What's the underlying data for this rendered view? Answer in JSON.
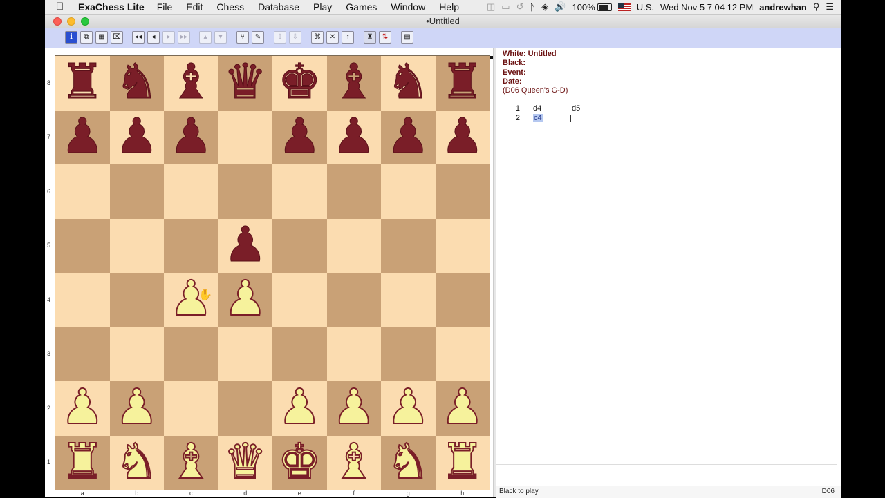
{
  "menubar": {
    "app_name": "ExaChess Lite",
    "items": [
      "File",
      "Edit",
      "Chess",
      "Database",
      "Play",
      "Games",
      "Window",
      "Help"
    ],
    "battery": "100%",
    "input_source": "U.S.",
    "clock": "Wed Nov 5  7 04 12 PM",
    "user": "andrewhan"
  },
  "window": {
    "title": "•Untitled"
  },
  "toolbar": {
    "buttons": [
      {
        "name": "info",
        "glyph": "i"
      },
      {
        "name": "copy",
        "glyph": "⧉"
      },
      {
        "name": "board",
        "glyph": "▦"
      },
      {
        "name": "delete",
        "glyph": "⌧"
      },
      {
        "name": "first",
        "glyph": "◂◂"
      },
      {
        "name": "prev",
        "glyph": "◂"
      },
      {
        "name": "next",
        "glyph": "▸"
      },
      {
        "name": "last",
        "glyph": "▸▸"
      },
      {
        "name": "var-up",
        "glyph": "▴"
      },
      {
        "name": "var-down",
        "glyph": "▾"
      },
      {
        "name": "tree",
        "glyph": "⑂"
      },
      {
        "name": "annotate",
        "glyph": "✎"
      },
      {
        "name": "promote",
        "glyph": "⇧"
      },
      {
        "name": "demote",
        "glyph": "⇩"
      },
      {
        "name": "analyze",
        "glyph": "⌘"
      },
      {
        "name": "stop",
        "glyph": "✕"
      },
      {
        "name": "go",
        "glyph": "↑"
      },
      {
        "name": "pieces",
        "glyph": "♜"
      },
      {
        "name": "flip",
        "glyph": "⇅"
      },
      {
        "name": "notes",
        "glyph": "▤"
      }
    ]
  },
  "board": {
    "rank_labels": [
      "8",
      "7",
      "6",
      "5",
      "4",
      "3",
      "2",
      "1"
    ],
    "file_labels": [
      "a",
      "b",
      "c",
      "d",
      "e",
      "f",
      "g",
      "h"
    ],
    "position": [
      [
        "r",
        "n",
        "b",
        "q",
        "k",
        "b",
        "n",
        "r"
      ],
      [
        "p",
        "p",
        "p",
        "",
        "p",
        "p",
        "p",
        "p"
      ],
      [
        "",
        "",
        "",
        "",
        "",
        "",
        "",
        ""
      ],
      [
        "",
        "",
        "",
        "p",
        "",
        "",
        "",
        ""
      ],
      [
        "",
        "",
        "P",
        "P",
        "",
        "",
        "",
        ""
      ],
      [
        "",
        "",
        "",
        "",
        "",
        "",
        "",
        ""
      ],
      [
        "P",
        "P",
        "",
        "",
        "P",
        "P",
        "P",
        "P"
      ],
      [
        "R",
        "N",
        "B",
        "Q",
        "K",
        "B",
        "N",
        "R"
      ]
    ]
  },
  "game_header": {
    "white_label": "White:",
    "white": "Untitled",
    "black_label": "Black:",
    "event_label": "Event:",
    "date_label": "Date:",
    "opening": "(D06 Queen's G-D)"
  },
  "moves": [
    {
      "num": "1",
      "white": "d4",
      "black": "d5"
    },
    {
      "num": "2",
      "white": "c4",
      "black": ""
    }
  ],
  "status": {
    "to_play": "Black to play",
    "eco": "D06"
  },
  "colors": {
    "light_square": "#fbdcb0",
    "dark_square": "#c9a176",
    "black_piece": "#7a1e28",
    "white_piece": "#f6f29c",
    "toolbar": "#cfd6f7"
  }
}
